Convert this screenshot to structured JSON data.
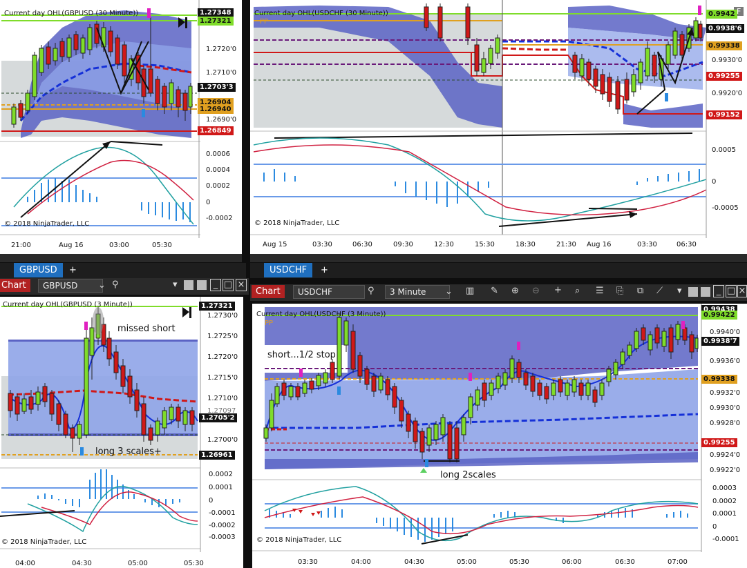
{
  "tabs": {
    "left": {
      "label": "GBPUSD",
      "add": "+"
    },
    "right": {
      "label": "USDCHF",
      "add": "+"
    }
  },
  "toolbar_left": {
    "chart_button": "Chart",
    "instrument": "GBPUSD"
  },
  "toolbar_right": {
    "chart_button": "Chart",
    "instrument": "USDCHF",
    "interval": "3 Minute"
  },
  "charts": {
    "tl": {
      "indicator_title": "Current day OHL(GBPUSD (30 Minute))",
      "copyright": "© 2018 NinjaTrader, LLC",
      "price_ticks": [
        "1.2720'0",
        "1.2710'0",
        "1.2690'0"
      ],
      "price_labels": {
        "top": "1.27348",
        "green": "1.27321",
        "current": "1.2703'3",
        "orange1": "1.26904",
        "orange2": "1.26940",
        "red": "1.26849"
      },
      "osc_ticks": [
        "0.0006",
        "0.0004",
        "0.0002",
        "0",
        "-0.0002"
      ],
      "time_ticks": [
        "21:00",
        "Aug 16",
        "03:00",
        "05:30"
      ]
    },
    "tr": {
      "indicator_title": "Current day OHL(USDCHF (30 Minute))",
      "pp": "PP",
      "copyright": "© 2018 NinjaTrader, LLC",
      "price_ticks": [
        "0.9930'0",
        "0.9920'0"
      ],
      "price_labels": {
        "green": "0.9942",
        "current": "0.9938'6",
        "orange": "0.99338",
        "red1": "0.99255",
        "red2": "0.99152"
      },
      "osc_ticks": [
        "0.0005",
        "0",
        "-0.0005"
      ],
      "time_ticks": [
        "Aug 15",
        "03:30",
        "06:30",
        "09:30",
        "12:30",
        "15:30",
        "18:30",
        "21:30",
        "Aug 16",
        "03:30",
        "06:30"
      ],
      "corner": "F"
    },
    "bl": {
      "indicator_title": "Current day OHL(GBPUSD (3 Minute))",
      "copyright": "© 2018 NinjaTrader, LLC",
      "price_ticks": [
        "1.2730'0",
        "1.2725'0",
        "1.2720'0",
        "1.2715'0",
        "1.2710'0",
        "1.2700'0"
      ],
      "price_labels": {
        "green": "1.27321",
        "current": "1.2705'2",
        "yellow": "1.26961",
        "hidden": "1.27097"
      },
      "osc_ticks": [
        "0.0002",
        "0.0001",
        "0",
        "-0.0001",
        "-0.0002",
        "-0.0003"
      ],
      "time_ticks": [
        "04:00",
        "04:30",
        "05:00",
        "05:30"
      ],
      "notes": {
        "missed_short": "missed short",
        "long": "long  3 scales+"
      }
    },
    "br": {
      "indicator_title": "Current day OHL(USDCHF (3 Minute))",
      "pp": "PP",
      "copyright": "© 2018 NinjaTrader, LLC",
      "price_ticks": [
        "0.9940'0",
        "0.9936'0",
        "0.9932'0",
        "0.9930'0",
        "0.9928'0",
        "0.9924'0",
        "0.9922'0"
      ],
      "price_labels": {
        "top": "0.99438",
        "green": "0.99422",
        "current": "0.9938'7",
        "orange": "0.99338",
        "red": "0.99255"
      },
      "osc_ticks": [
        "0.0003",
        "0.0002",
        "0.0001",
        "0",
        "-0.0001"
      ],
      "time_ticks": [
        "03:30",
        "04:00",
        "04:30",
        "05:00",
        "05:30",
        "06:00",
        "06:30",
        "07:00"
      ],
      "notes": {
        "short": "short...1/2 stop",
        "long": "long  2scales"
      }
    }
  },
  "colors": {
    "band": "#5b63c4",
    "band_light": "#8fa4e8",
    "grey_fill": "#d6dadb",
    "green": "#7fdc2a",
    "orange": "#e0a020",
    "red": "#d01818",
    "purple": "#6a1a7a",
    "blue_mid": "#1530d8",
    "hist": "#2a8ae0",
    "tab_active": "#1f6fbf"
  }
}
